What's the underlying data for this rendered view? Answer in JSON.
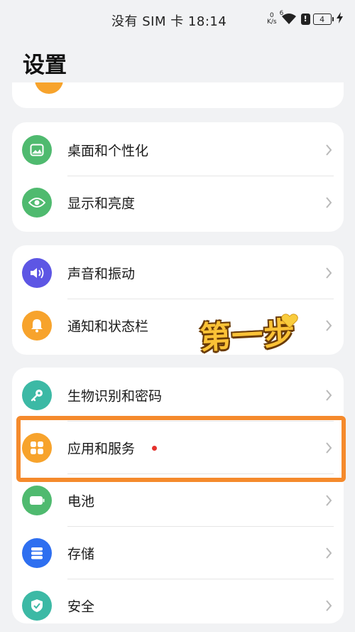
{
  "status_bar": {
    "carrier_time": "没有 SIM 卡 18:14",
    "net_speed_value": "0",
    "net_speed_unit": "K/s",
    "wifi_label": "6",
    "battery_level": "4"
  },
  "header": {
    "title": "设置"
  },
  "groups": [
    {
      "items": [
        {
          "label": "桌面和个性化",
          "icon": "wallpaper-icon",
          "color": "#4fba6f"
        },
        {
          "label": "显示和亮度",
          "icon": "eye-icon",
          "color": "#4fba6f"
        }
      ]
    },
    {
      "items": [
        {
          "label": "声音和振动",
          "icon": "speaker-icon",
          "color": "#5d56e4"
        },
        {
          "label": "通知和状态栏",
          "icon": "bell-icon",
          "color": "#f7a32c"
        }
      ]
    },
    {
      "items": [
        {
          "label": "生物识别和密码",
          "icon": "key-icon",
          "color": "#3cb9a5"
        },
        {
          "label": "应用和服务",
          "icon": "apps-icon",
          "color": "#f7a32c",
          "badge": "red-dot"
        },
        {
          "label": "电池",
          "icon": "battery-icon",
          "color": "#4fba6f"
        },
        {
          "label": "存储",
          "icon": "storage-icon",
          "color": "#2e6ff0"
        },
        {
          "label": "安全",
          "icon": "shield-icon",
          "color": "#3cb9a5"
        }
      ]
    }
  ],
  "annotation": {
    "text": "第一步",
    "emoji": "yellow-heart-icon",
    "highlight_color": "#f58a2c"
  }
}
